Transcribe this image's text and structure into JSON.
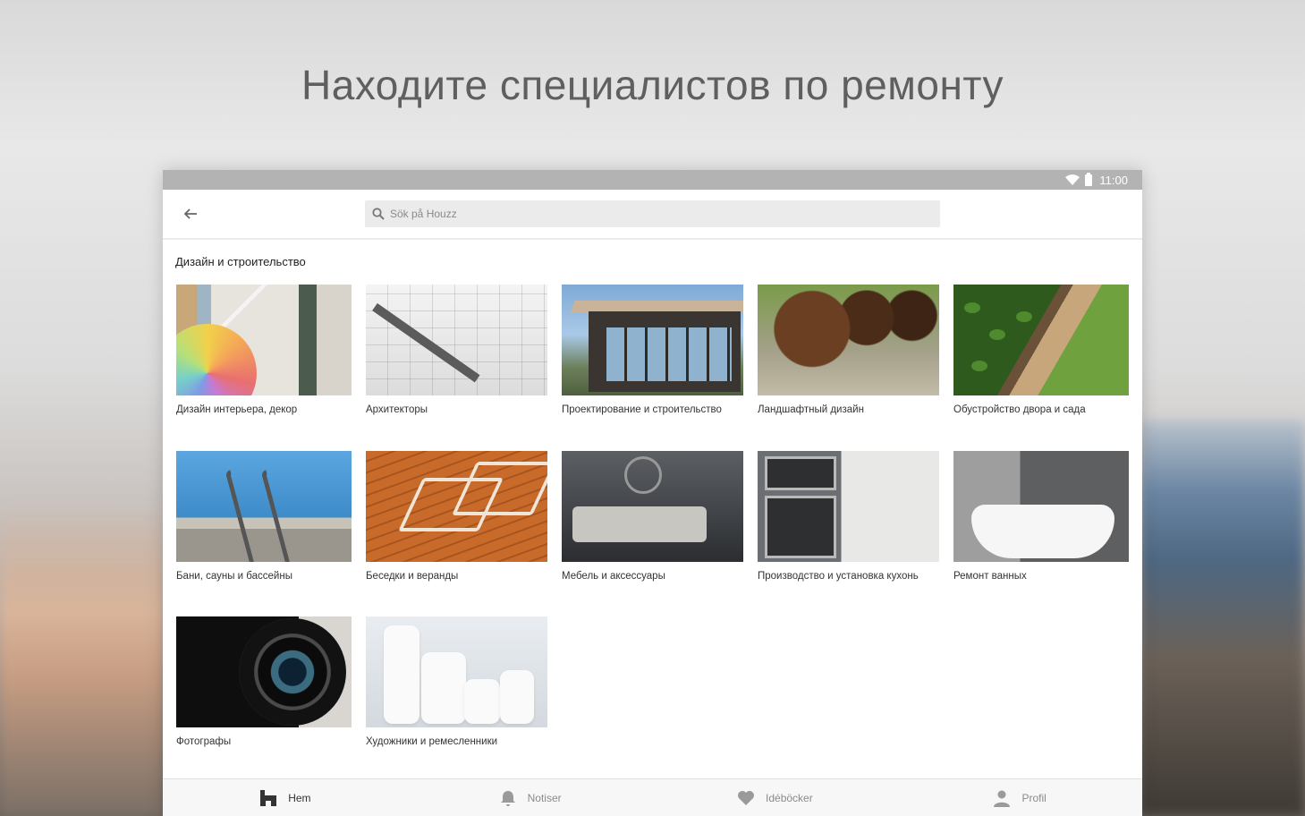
{
  "headline": "Находите специалистов по ремонту",
  "status_bar": {
    "time": "11:00",
    "icons": [
      "wifi-icon",
      "battery-icon"
    ]
  },
  "app_bar": {
    "back_icon": "arrow-left-icon",
    "search_placeholder": "Sök på Houzz",
    "search_icon": "search-icon"
  },
  "section": {
    "title": "Дизайн и строительство"
  },
  "categories": [
    {
      "label": "Дизайн интерьера, декор"
    },
    {
      "label": "Архитекторы"
    },
    {
      "label": "Проектирование и строительство"
    },
    {
      "label": "Ландшафтный дизайн"
    },
    {
      "label": "Обустройство двора и сада"
    },
    {
      "label": "Бани, сауны и бассейны"
    },
    {
      "label": "Беседки и веранды"
    },
    {
      "label": "Мебель и аксессуары"
    },
    {
      "label": "Производство и установка кухонь"
    },
    {
      "label": "Ремонт ванных"
    },
    {
      "label": "Фотографы"
    },
    {
      "label": "Художники и ремесленники"
    }
  ],
  "bottom_nav": [
    {
      "label": "Hem",
      "icon": "home-icon",
      "active": true
    },
    {
      "label": "Notiser",
      "icon": "bell-icon",
      "active": false
    },
    {
      "label": "Idéböcker",
      "icon": "heart-icon",
      "active": false
    },
    {
      "label": "Profil",
      "icon": "user-icon",
      "active": false
    }
  ],
  "colors": {
    "status_bar": "#b3b3b3",
    "search_bg": "#ebebeb",
    "active_nav": "#333333",
    "inactive_nav": "#8a8a8a"
  }
}
